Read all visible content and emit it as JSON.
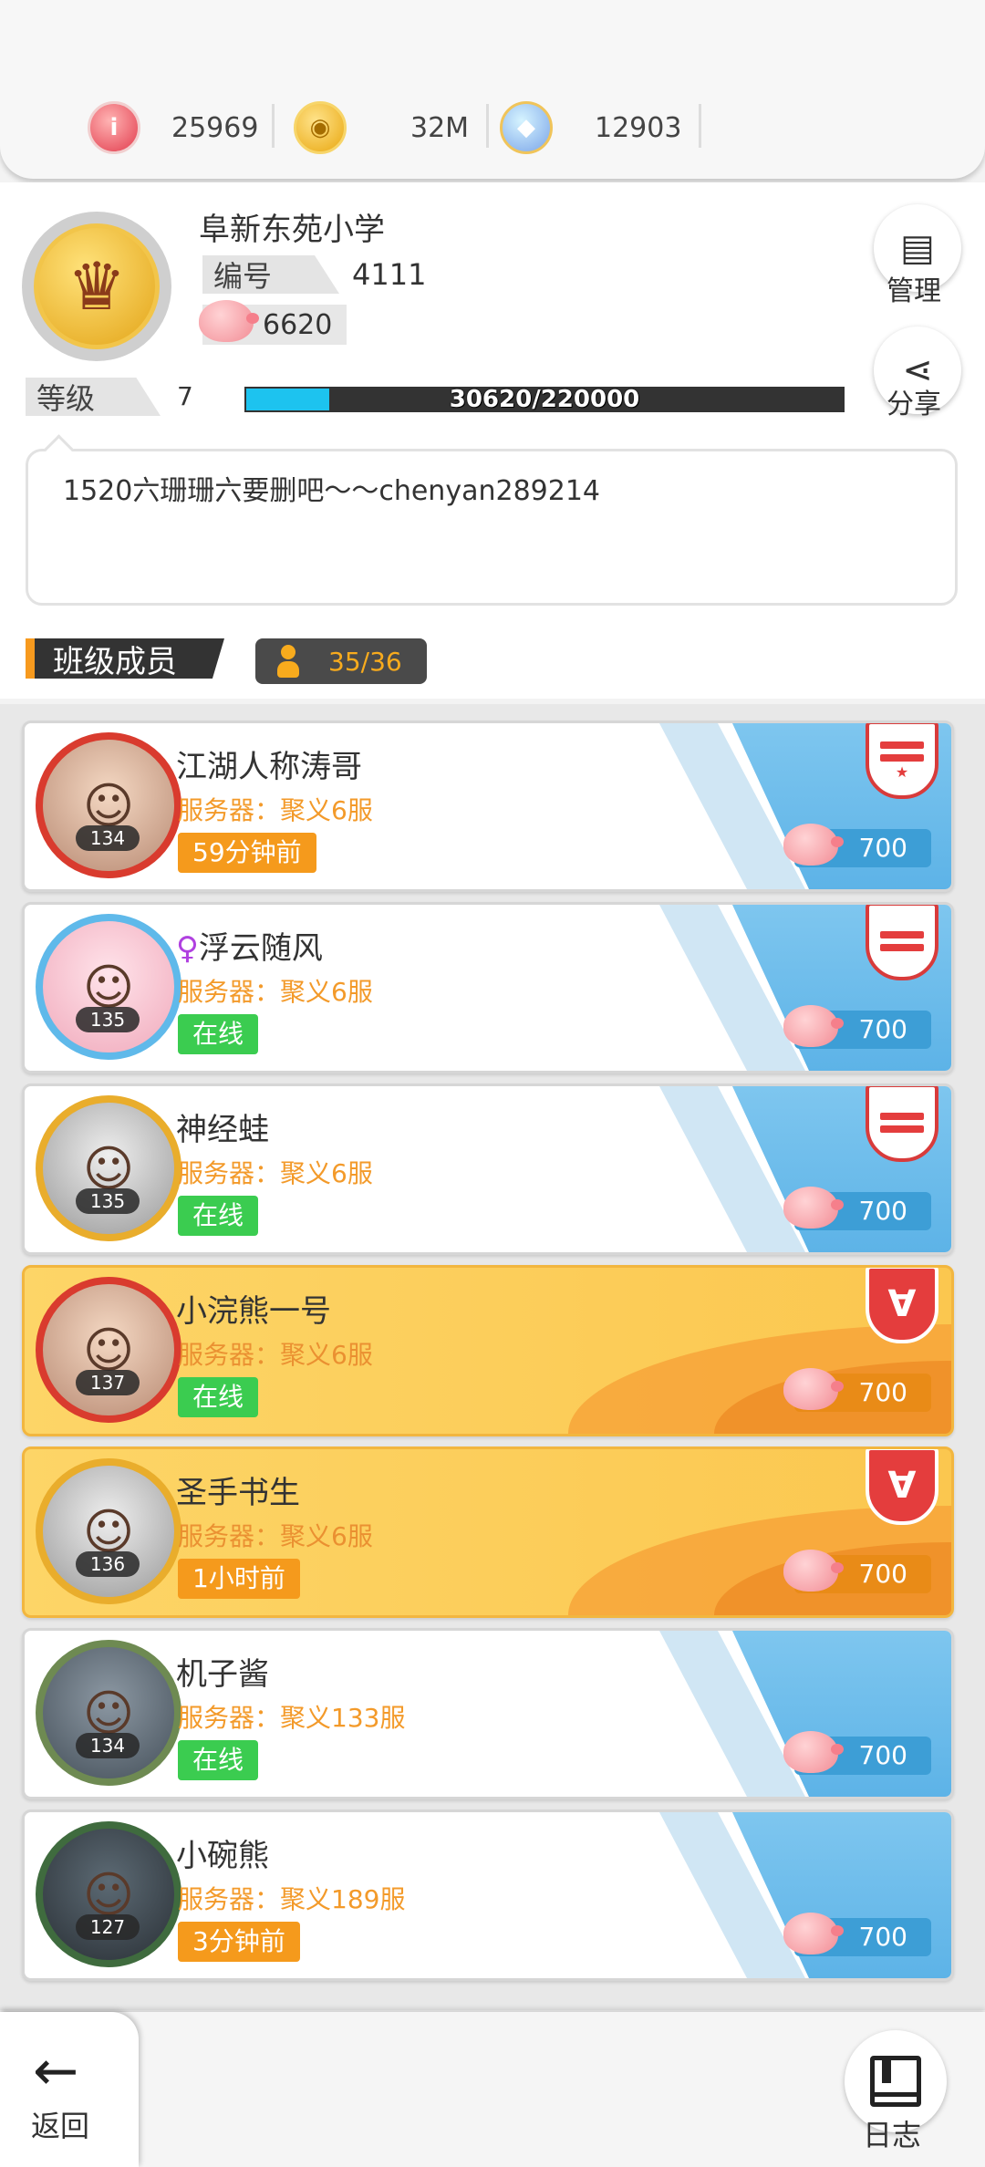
{
  "resources": [
    {
      "icon": "coupon-icon",
      "glyph": "i",
      "value": "25969"
    },
    {
      "icon": "gold-coin-icon",
      "glyph": "◉",
      "value": "32M"
    },
    {
      "icon": "gem-ring-icon",
      "glyph": "◆",
      "value": "12903"
    }
  ],
  "school": {
    "name": "阜新东苑小学",
    "code_label": "编号",
    "code_value": "4111",
    "pig_value": "6620",
    "level_label": "等级",
    "level_value": "7",
    "xp_text": "30620/220000",
    "xp_fraction": 0.139
  },
  "actions": {
    "manage_label": "管理",
    "share_label": "分享"
  },
  "motto": "1520六珊珊六要删吧～～chenyan289214",
  "members_section": {
    "title": "班级成员",
    "count": "35/36"
  },
  "members": [
    {
      "name": "江湖人称涛哥",
      "fem": "",
      "level": "134",
      "server": "服务器：聚义6服",
      "status": "59分钟前",
      "status_type": "ago",
      "points": "700",
      "style": "white",
      "role": "leader",
      "ring": "red"
    },
    {
      "name": "浮云随风",
      "fem": "♀",
      "level": "135",
      "server": "服务器：聚义6服",
      "status": "在线",
      "status_type": "online",
      "points": "700",
      "style": "white",
      "role": "officer",
      "ring": "blue"
    },
    {
      "name": "神经蛙",
      "fem": "",
      "level": "135",
      "server": "服务器：聚义6服",
      "status": "在线",
      "status_type": "online",
      "points": "700",
      "style": "white",
      "role": "officer",
      "ring": "gold"
    },
    {
      "name": "小浣熊一号",
      "fem": "",
      "level": "137",
      "server": "服务器：聚义6服",
      "status": "在线",
      "status_type": "online",
      "points": "700",
      "style": "gold",
      "role": "vip",
      "ring": "red"
    },
    {
      "name": "圣手书生",
      "fem": "",
      "level": "136",
      "server": "服务器：聚义6服",
      "status": "1小时前",
      "status_type": "ago",
      "points": "700",
      "style": "gold",
      "role": "vip",
      "ring": "gold"
    },
    {
      "name": "机子酱",
      "fem": "",
      "level": "134",
      "server": "服务器：聚义133服",
      "status": "在线",
      "status_type": "online",
      "points": "700",
      "style": "white",
      "role": "",
      "ring": "green"
    },
    {
      "name": "小碗熊",
      "fem": "",
      "level": "127",
      "server": "服务器：聚义189服",
      "status": "3分钟前",
      "status_type": "ago",
      "points": "700",
      "style": "white",
      "role": "",
      "ring": "dark"
    }
  ],
  "bottom": {
    "back_label": "返回",
    "log_label": "日志"
  },
  "colors": {
    "xp_fill": "#1dc3ef",
    "online": "#3bcc50",
    "ago": "#f59a1c",
    "points_blue": "#3d9ed6",
    "points_gold": "#e98b17"
  }
}
